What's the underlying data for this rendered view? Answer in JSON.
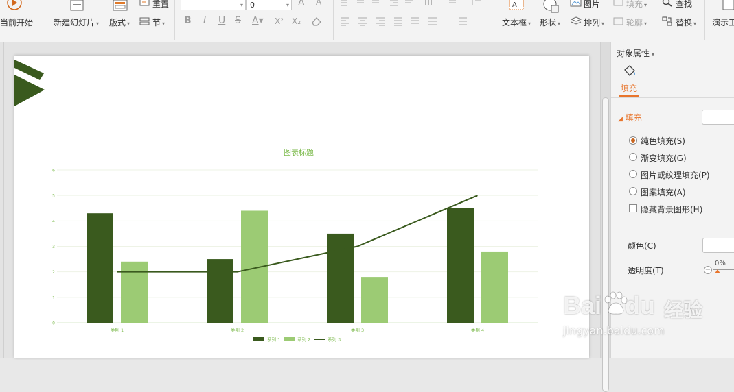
{
  "ribbon": {
    "from_current_label": "当前开始",
    "new_slide_label": "新建幻灯片",
    "layout_label": "版式",
    "reset_label": "重置",
    "section_label": "节",
    "font_size_value": "0",
    "font_size_up": "A",
    "font_size_down": "A",
    "bold": "B",
    "italic": "I",
    "underline": "U",
    "strikethrough": "S",
    "font_color": "A",
    "superscript": "X²",
    "subscript": "X₂",
    "textbox_label": "文本框",
    "shape_label": "形状",
    "picture_label": "图片",
    "arrange_label": "排列",
    "fill_label": "填充",
    "outline_label": "轮廓",
    "find_label": "查找",
    "replace_label": "替换",
    "presentation_tools_label": "演示工"
  },
  "panel": {
    "title": "对象属性",
    "tab_fill": "填充",
    "section_fill": "填充",
    "options": [
      {
        "label": "纯色填充(S)",
        "selected": true
      },
      {
        "label": "渐变填充(G)",
        "selected": false
      },
      {
        "label": "图片或纹理填充(P)",
        "selected": false
      },
      {
        "label": "图案填充(A)",
        "selected": false
      }
    ],
    "hide_bg_label": "隐藏背景图形(H)",
    "color_label": "颜色(C)",
    "transparency_label": "透明度(T)",
    "transparency_value": "0%",
    "accent_color": "#e8752c"
  },
  "chart_data": {
    "type": "bar",
    "title": "图表标题",
    "categories": [
      "类别 1",
      "类别 2",
      "类别 3",
      "类别 4"
    ],
    "series": [
      {
        "name": "系列 1",
        "type": "bar",
        "color": "#3a5a1e",
        "values": [
          4.3,
          2.5,
          3.5,
          4.5
        ]
      },
      {
        "name": "系列 2",
        "type": "bar",
        "color": "#9ccb74",
        "values": [
          2.4,
          4.4,
          1.8,
          2.8
        ]
      },
      {
        "name": "系列 3",
        "type": "line",
        "color": "#3a5a1e",
        "values": [
          2,
          2,
          3,
          5
        ]
      }
    ],
    "ylim": [
      0,
      6
    ],
    "yticks": [
      "0",
      "1",
      "2",
      "3",
      "4",
      "5",
      "6"
    ],
    "grid": true,
    "legend": "bottom"
  },
  "watermark": {
    "brand": "Bai",
    "brand2": "du",
    "brand_cn": "经验",
    "url": "jingyan.baidu.com"
  }
}
